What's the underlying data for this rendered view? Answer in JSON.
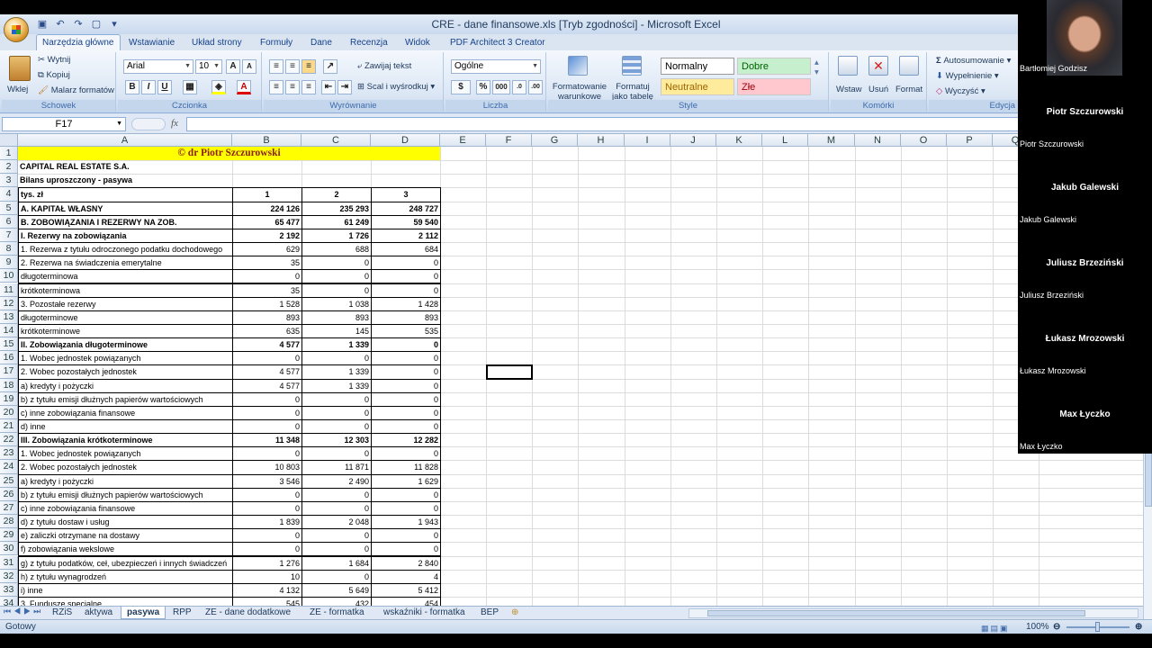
{
  "window": {
    "title": "CRE - dane finansowe.xls  [Tryb zgodności] - Microsoft Excel"
  },
  "ribbon_tabs": [
    "Narzędzia główne",
    "Wstawianie",
    "Układ strony",
    "Formuły",
    "Dane",
    "Recenzja",
    "Widok",
    "PDF Architect 3 Creator"
  ],
  "clipboard": {
    "paste": "Wklej",
    "cut": "Wytnij",
    "copy": "Kopiuj",
    "format_painter": "Malarz formatów",
    "label": "Schowek"
  },
  "font": {
    "name": "Arial",
    "size": "10",
    "label": "Czcionka",
    "bold": "B",
    "italic": "I",
    "underline": "U"
  },
  "alignment": {
    "wrap": "Zawijaj tekst",
    "merge": "Scal i wyśrodkuj",
    "label": "Wyrównanie"
  },
  "number": {
    "format": "Ogólne",
    "label": "Liczba",
    "percent": "%",
    "thousands": "000"
  },
  "styles": {
    "conditional": "Formatowanie warunkowe",
    "as_table": "Formatuj jako tabelę",
    "normal": "Normalny",
    "good": "Dobre",
    "neutral": "Neutralne",
    "bad": "Złe",
    "label": "Style"
  },
  "cells": {
    "insert": "Wstaw",
    "delete": "Usuń",
    "format": "Format",
    "label": "Komórki"
  },
  "editing": {
    "autosum": "Autosumowanie",
    "fill": "Wypełnienie",
    "clear": "Wyczyść",
    "label": "Edycja"
  },
  "formula_bar": {
    "namebox": "F17",
    "fx": "fx"
  },
  "columns": [
    "A",
    "B",
    "C",
    "D",
    "E",
    "F",
    "G",
    "H",
    "I",
    "J",
    "K",
    "L",
    "M",
    "N",
    "O",
    "P",
    "Q"
  ],
  "sheet": {
    "rows": [
      {
        "n": "1",
        "a": "© dr Piotr Szczurowski",
        "b": "",
        "c": "",
        "d": "",
        "style": "banner"
      },
      {
        "n": "2",
        "a": "CAPITAL REAL ESTATE S.A.",
        "b": "",
        "c": "",
        "d": "",
        "style": "boldplain"
      },
      {
        "n": "3",
        "a": "Bilans uproszczony - pasywa",
        "b": "",
        "c": "",
        "d": "",
        "style": "boldplain"
      },
      {
        "n": "4",
        "a": "tys. zł",
        "b": "1",
        "c": "2",
        "d": "3",
        "style": "header"
      },
      {
        "n": "5",
        "a": "A. KAPITAŁ WŁASNY",
        "b": "224 126",
        "c": "235 293",
        "d": "248 727",
        "style": "bold"
      },
      {
        "n": "6",
        "a": "B. ZOBOWIĄZANIA I REZERWY NA ZOB.",
        "b": "65 477",
        "c": "61 249",
        "d": "59 540",
        "style": "bold"
      },
      {
        "n": "7",
        "a": "I. Rezerwy na zobowiązania",
        "b": "2 192",
        "c": "1 726",
        "d": "2 112",
        "style": "bold"
      },
      {
        "n": "8",
        "a": "1. Rezerwa z tytułu odroczonego podatku dochodowego",
        "b": "629",
        "c": "688",
        "d": "684",
        "style": ""
      },
      {
        "n": "9",
        "a": "2. Rezerwa na świadczenia emerytalne",
        "b": "35",
        "c": "0",
        "d": "0",
        "style": ""
      },
      {
        "n": "10",
        "a": "długoterminowa",
        "b": "0",
        "c": "0",
        "d": "0",
        "style": ""
      },
      {
        "n": "11",
        "a": "krótkoterminowa",
        "b": "35",
        "c": "0",
        "d": "0",
        "style": ""
      },
      {
        "n": "12",
        "a": "3. Pozostałe rezerwy",
        "b": "1 528",
        "c": "1 038",
        "d": "1 428",
        "style": ""
      },
      {
        "n": "13",
        "a": "długoterminowe",
        "b": "893",
        "c": "893",
        "d": "893",
        "style": ""
      },
      {
        "n": "14",
        "a": "krótkoterminowe",
        "b": "635",
        "c": "145",
        "d": "535",
        "style": ""
      },
      {
        "n": "15",
        "a": "II. Zobowiązania długoterminowe",
        "b": "4 577",
        "c": "1 339",
        "d": "0",
        "style": "bold"
      },
      {
        "n": "16",
        "a": "1. Wobec jednostek powiązanych",
        "b": "0",
        "c": "0",
        "d": "0",
        "style": ""
      },
      {
        "n": "17",
        "a": "2. Wobec pozostałych jednostek",
        "b": "4 577",
        "c": "1 339",
        "d": "0",
        "style": ""
      },
      {
        "n": "18",
        "a": "a) kredyty i pożyczki",
        "b": "4 577",
        "c": "1 339",
        "d": "0",
        "style": ""
      },
      {
        "n": "19",
        "a": "b) z tytułu emisji dłużnych papierów wartościowych",
        "b": "0",
        "c": "0",
        "d": "0",
        "style": ""
      },
      {
        "n": "20",
        "a": "c) inne zobowiązania finansowe",
        "b": "0",
        "c": "0",
        "d": "0",
        "style": ""
      },
      {
        "n": "21",
        "a": "d) inne",
        "b": "0",
        "c": "0",
        "d": "0",
        "style": ""
      },
      {
        "n": "22",
        "a": "III. Zobowiązania krótkoterminowe",
        "b": "11 348",
        "c": "12 303",
        "d": "12 282",
        "style": "bold"
      },
      {
        "n": "23",
        "a": "1. Wobec jednostek powiązanych",
        "b": "0",
        "c": "0",
        "d": "0",
        "style": ""
      },
      {
        "n": "24",
        "a": "2. Wobec pozostałych jednostek",
        "b": "10 803",
        "c": "11 871",
        "d": "11 828",
        "style": ""
      },
      {
        "n": "25",
        "a": "a) kredyty i pożyczki",
        "b": "3 546",
        "c": "2 490",
        "d": "1 629",
        "style": ""
      },
      {
        "n": "26",
        "a": "b) z tytułu emisji dłużnych papierów wartościowych",
        "b": "0",
        "c": "0",
        "d": "0",
        "style": ""
      },
      {
        "n": "27",
        "a": "c) inne zobowiązania finansowe",
        "b": "0",
        "c": "0",
        "d": "0",
        "style": ""
      },
      {
        "n": "28",
        "a": "d) z tytułu dostaw i usług",
        "b": "1 839",
        "c": "2 048",
        "d": "1 943",
        "style": ""
      },
      {
        "n": "29",
        "a": "e) zaliczki otrzymane na dostawy",
        "b": "0",
        "c": "0",
        "d": "0",
        "style": ""
      },
      {
        "n": "30",
        "a": "f)  zobowiązania wekslowe",
        "b": "0",
        "c": "0",
        "d": "0",
        "style": ""
      },
      {
        "n": "31",
        "a": "g) z tytułu podatków, ceł, ubezpieczeń i innych świadczeń",
        "b": "1 276",
        "c": "1 684",
        "d": "2 840",
        "style": ""
      },
      {
        "n": "32",
        "a": "h) z tytułu wynagrodzeń",
        "b": "10",
        "c": "0",
        "d": "4",
        "style": ""
      },
      {
        "n": "33",
        "a": "i) inne",
        "b": "4 132",
        "c": "5 649",
        "d": "5 412",
        "style": ""
      },
      {
        "n": "34",
        "a": "3. Fundusze specjalne",
        "b": "545",
        "c": "432",
        "d": "454",
        "style": ""
      }
    ]
  },
  "sheet_tabs": [
    "RZiS",
    "aktywa",
    "pasywa",
    "RPP",
    "ZE - dane dodatkowe",
    "ZE - formatka",
    "wskaźniki - formatka",
    "BEP"
  ],
  "active_sheet": "pasywa",
  "status": {
    "ready": "Gotowy",
    "zoom": "100%"
  },
  "participants": {
    "self": "Bartłomiej Godzisz",
    "others": [
      "Piotr Szczurowski",
      "Jakub Galewski",
      "Juliusz Brzeziński",
      "Łukasz Mrozowski",
      "Max Łyczko"
    ]
  }
}
